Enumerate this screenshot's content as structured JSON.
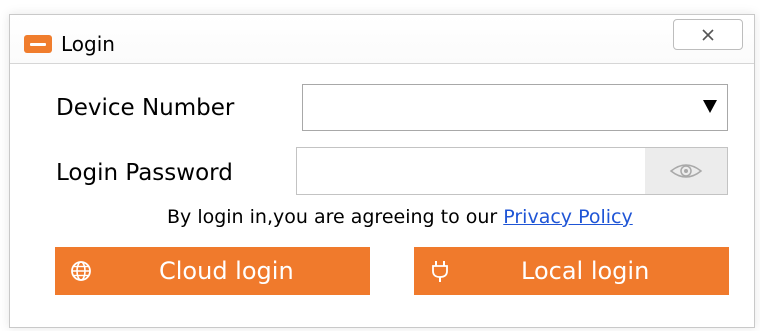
{
  "window": {
    "title": "Login",
    "icon": "app-logo-icon",
    "close_icon": "close-icon"
  },
  "form": {
    "device_number_label": "Device Number",
    "device_number_value": "",
    "password_label": "Login Password",
    "password_value": "",
    "eye_icon": "eye-icon"
  },
  "agreement": {
    "text": "By login in,you are agreeing to our ",
    "link_text": "Privacy Policy"
  },
  "buttons": {
    "cloud_login_label": "Cloud login",
    "cloud_icon": "globe-icon",
    "local_login_label": "Local login",
    "local_icon": "plug-icon"
  },
  "colors": {
    "accent": "#f07a2c",
    "link": "#1f55d6"
  }
}
